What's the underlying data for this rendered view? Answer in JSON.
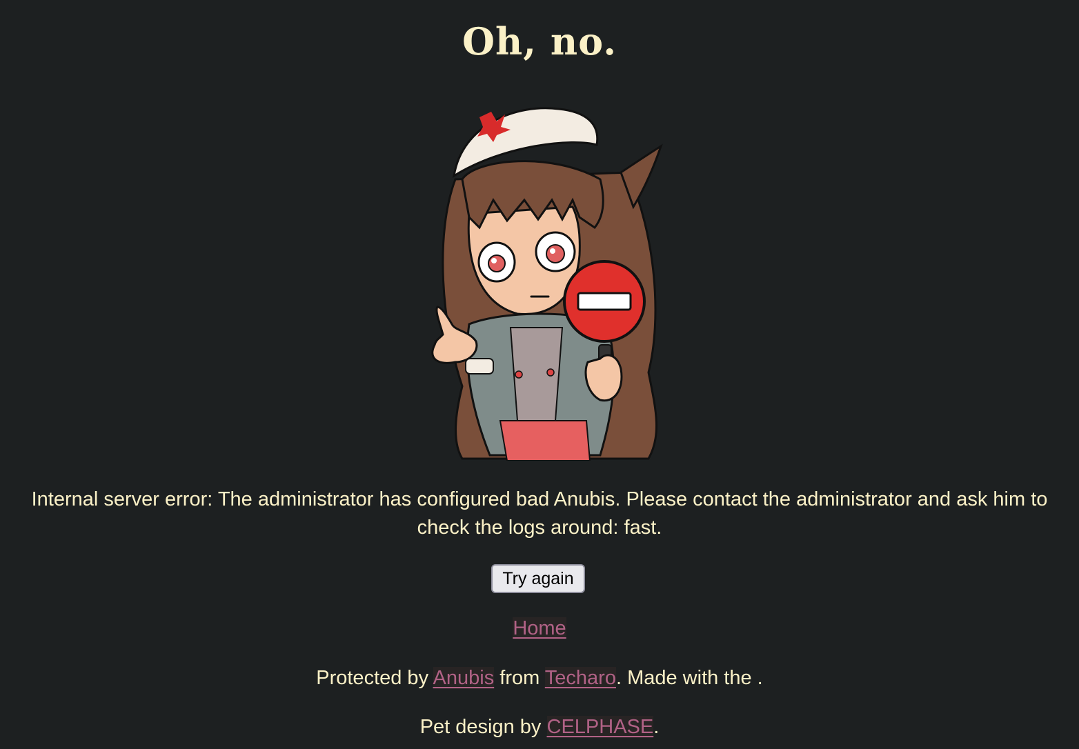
{
  "title": "Oh, no.",
  "error_message": "Internal server error: The administrator has configured bad Anubis. Please contact the administrator and ask him to check the logs around: fast.",
  "retry_button_label": "Try again",
  "home_link_label": "Home",
  "footer": {
    "protected_prefix": "Protected by ",
    "anubis_link": "Anubis",
    "from_text": " from ",
    "techaro_link": "Techaro",
    "made_with_text": ". Made with the .",
    "pet_prefix": "Pet design by ",
    "celphase_link": "CELPHASE",
    "pet_suffix": "."
  },
  "mascot": {
    "icon": "anubis-mascot-stop-sign-icon"
  },
  "colors": {
    "background": "#1d2021",
    "text": "#fbf1c7",
    "link": "#b16286",
    "stop_sign": "#e0302c"
  }
}
